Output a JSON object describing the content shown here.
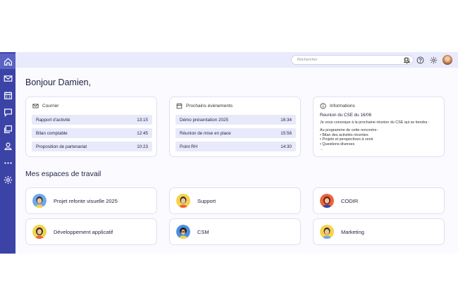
{
  "sidebar": {
    "items": [
      {
        "icon": "home-icon",
        "active": true
      },
      {
        "icon": "mail-icon"
      },
      {
        "icon": "calendar-icon"
      },
      {
        "icon": "chat-icon"
      },
      {
        "icon": "folders-icon"
      },
      {
        "icon": "user-icon"
      },
      {
        "icon": "more-icon"
      },
      {
        "icon": "settings-icon"
      }
    ]
  },
  "topbar": {
    "search_placeholder": "Rechercher",
    "icons": [
      "search-icon",
      "bell-icon",
      "help-icon",
      "gear-icon"
    ]
  },
  "greeting": "Bonjour Damien,",
  "mail_card": {
    "title": "Courrier",
    "rows": [
      {
        "label": "Rapport d'activité",
        "time": "13:15"
      },
      {
        "label": "Bilan comptable",
        "time": "12:45"
      },
      {
        "label": "Proposition de partenariat",
        "time": "10:23"
      }
    ]
  },
  "events_card": {
    "title": "Prochains événements",
    "rows": [
      {
        "label": "Démo présentation 2025",
        "time": "16:34"
      },
      {
        "label": "Réunion de mise en place",
        "time": "15:56"
      },
      {
        "label": "Point RH",
        "time": "14:30"
      }
    ]
  },
  "info_card": {
    "title": "Informations",
    "subject": "Reunion du CSE du 16/06",
    "lines": [
      "Je vous convoque à la prochaine réunion du CSE qui se tiendra :",
      "",
      "Au programme de cette rencontre :",
      "• Bilan des activités récentes",
      "• Projets et perspectives à venir",
      "• Questions diverses",
      "..."
    ]
  },
  "workspaces": {
    "title": "Mes espaces de travail",
    "items": [
      {
        "label": "Projet refonte visuelle 2025",
        "bg": "#6fa8e8",
        "hair": "#2b2b2b"
      },
      {
        "label": "Support",
        "bg": "#f5d34a",
        "hair": "#2b2b2b"
      },
      {
        "label": "CODIR",
        "bg": "#e8663a",
        "hair": "#6a1d1d"
      },
      {
        "label": "Développement applicatif",
        "bg": "#f5d34a",
        "hair": "#2b2b2b"
      },
      {
        "label": "CSM",
        "bg": "#4a8fe0",
        "hair": "#1f1f1f"
      },
      {
        "label": "Marketing",
        "bg": "#f5d34a",
        "hair": "#2b2b2b"
      }
    ]
  },
  "colors": {
    "sidebar": "#3b43a6",
    "topbar": "#e9eafc",
    "row_bg": "#e8eafb"
  }
}
